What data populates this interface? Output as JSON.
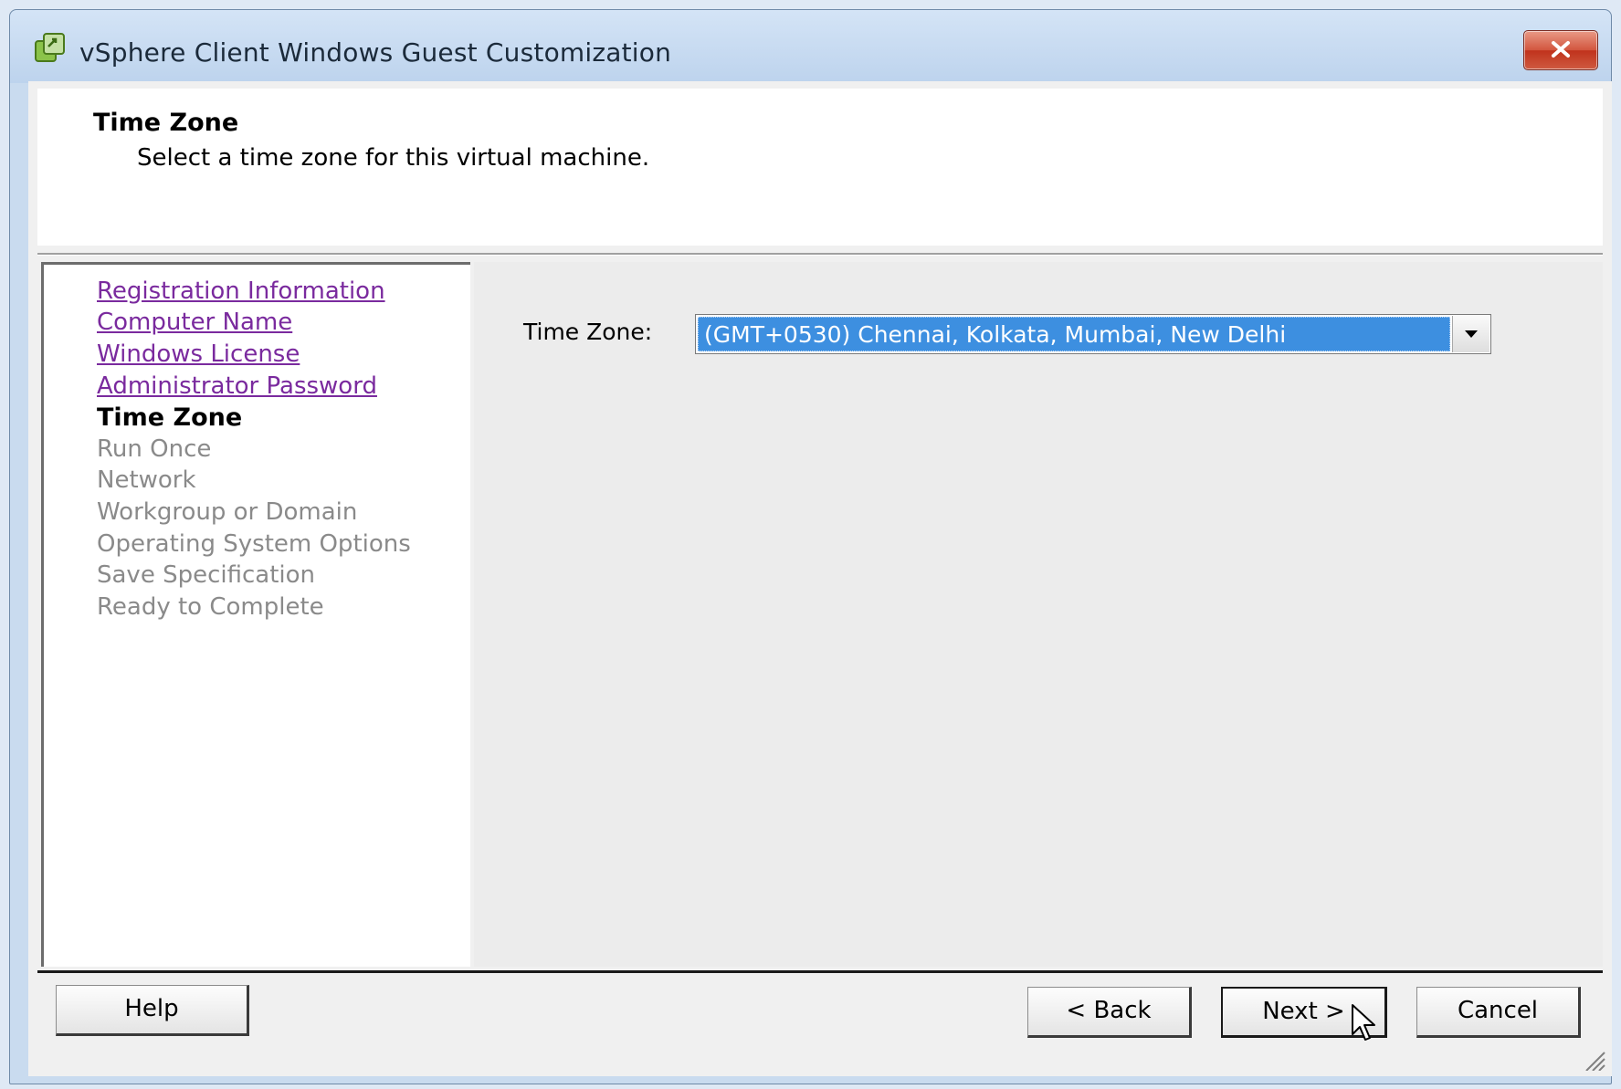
{
  "window": {
    "title": "vSphere Client Windows Guest Customization"
  },
  "header": {
    "title": "Time Zone",
    "subtitle": "Select a time zone for this virtual machine."
  },
  "nav": {
    "items": [
      {
        "label": "Registration Information",
        "state": "completed"
      },
      {
        "label": "Computer Name",
        "state": "completed"
      },
      {
        "label": "Windows License",
        "state": "completed"
      },
      {
        "label": "Administrator Password",
        "state": "completed"
      },
      {
        "label": "Time Zone",
        "state": "current"
      },
      {
        "label": "Run Once",
        "state": "pending"
      },
      {
        "label": "Network",
        "state": "pending"
      },
      {
        "label": "Workgroup or Domain",
        "state": "pending"
      },
      {
        "label": "Operating System Options",
        "state": "pending"
      },
      {
        "label": "Save Specification",
        "state": "pending"
      },
      {
        "label": "Ready to Complete",
        "state": "pending"
      }
    ]
  },
  "form": {
    "timezone_label": "Time Zone:",
    "timezone_value": "(GMT+0530) Chennai, Kolkata, Mumbai, New Delhi"
  },
  "buttons": {
    "help": "Help",
    "back": "< Back",
    "next": "Next >",
    "cancel": "Cancel"
  },
  "colors": {
    "link": "#7a2a9e",
    "selection": "#3d8fe0",
    "disabled_text": "#8a8a8a",
    "close_button": "#c0321c"
  },
  "icons": {
    "app": "vsphere-app-icon",
    "close": "close-icon",
    "dropdown": "chevron-down-icon",
    "cursor": "mouse-pointer-icon",
    "resize": "resize-grip-icon"
  }
}
